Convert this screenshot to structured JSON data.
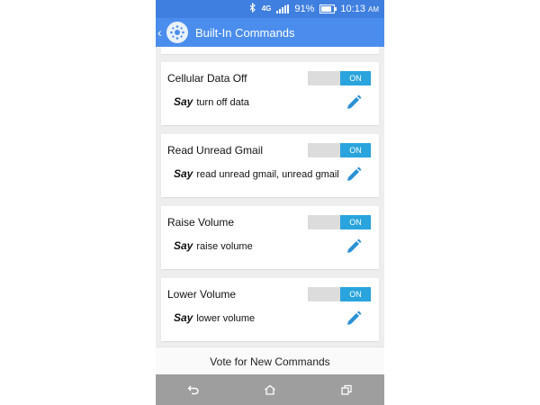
{
  "status_bar": {
    "battery_percent": "91%",
    "time": "10:13",
    "ampm": "AM",
    "network": "4G"
  },
  "app_bar": {
    "title": "Built-In Commands"
  },
  "commands": [
    {
      "title": "Cellular Data Off",
      "toggle_label": "ON",
      "say_label": "Say",
      "phrase": "turn off data"
    },
    {
      "title": "Read Unread Gmail",
      "toggle_label": "ON",
      "say_label": "Say",
      "phrase": "read unread gmail, unread gmail"
    },
    {
      "title": "Raise Volume",
      "toggle_label": "ON",
      "say_label": "Say",
      "phrase": "raise volume"
    },
    {
      "title": "Lower Volume",
      "toggle_label": "ON",
      "say_label": "Say",
      "phrase": "lower volume"
    }
  ],
  "footer": {
    "vote_label": "Vote for New Commands"
  },
  "colors": {
    "status_bar": "#3f7fe0",
    "app_bar": "#4a8ded",
    "toggle_on": "#2aa4dd",
    "edit_icon": "#2a8fd6"
  },
  "icons": {
    "back": "back-chevron-icon",
    "logo": "app-logo-icon",
    "edit": "pencil-icon",
    "nav": [
      "back-arrow-icon",
      "home-icon",
      "recent-apps-icon"
    ]
  }
}
